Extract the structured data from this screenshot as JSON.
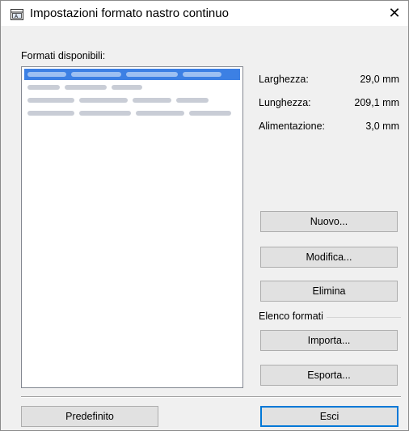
{
  "window": {
    "title": "Impostazioni formato nastro continuo",
    "close_glyph": "✕"
  },
  "formats": {
    "label": "Formati disponibili:",
    "items": [
      {
        "state": "selected",
        "widths": [
          48,
          62,
          64,
          48
        ]
      },
      {
        "state": "normal",
        "widths": [
          40,
          52,
          38
        ]
      },
      {
        "state": "normal",
        "widths": [
          58,
          60,
          48,
          40
        ]
      },
      {
        "state": "normal",
        "widths": [
          58,
          64,
          60,
          52
        ]
      }
    ]
  },
  "properties": {
    "width_label": "Larghezza:",
    "width_value": "29,0 mm",
    "length_label": "Lunghezza:",
    "length_value": "209,1 mm",
    "feed_label": "Alimentazione:",
    "feed_value": "3,0 mm"
  },
  "buttons": {
    "new": "Nuovo...",
    "edit": "Modifica...",
    "delete": "Elimina",
    "import": "Importa...",
    "export": "Esporta...",
    "default": "Predefinito",
    "exit": "Esci"
  },
  "groups": {
    "format_list": "Elenco formati"
  },
  "colors": {
    "selection": "#3c80e4",
    "default_button_border": "#0078d7",
    "dialog_bg": "#f0f0f0"
  },
  "icons": {
    "title": "tape-format-icon",
    "close": "close-icon"
  }
}
